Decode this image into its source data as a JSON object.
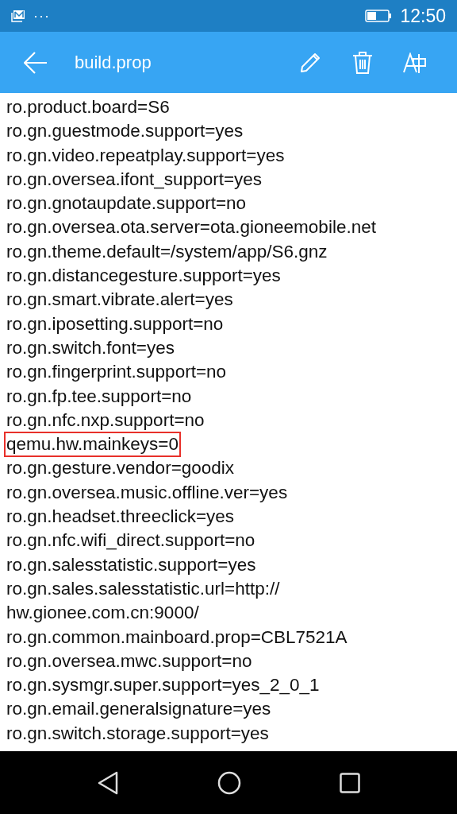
{
  "status_bar": {
    "time": "12:50",
    "overflow": "···"
  },
  "toolbar": {
    "title": "build.prop"
  },
  "lines": [
    {
      "text": "ro.product.board=S6",
      "highlighted": false
    },
    {
      "text": "ro.gn.guestmode.support=yes",
      "highlighted": false
    },
    {
      "text": "ro.gn.video.repeatplay.support=yes",
      "highlighted": false
    },
    {
      "text": "ro.gn.oversea.ifont_support=yes",
      "highlighted": false
    },
    {
      "text": "ro.gn.gnotaupdate.support=no",
      "highlighted": false
    },
    {
      "text": "ro.gn.oversea.ota.server=ota.gioneemobile.net",
      "highlighted": false
    },
    {
      "text": "ro.gn.theme.default=/system/app/S6.gnz",
      "highlighted": false
    },
    {
      "text": "ro.gn.distancegesture.support=yes",
      "highlighted": false
    },
    {
      "text": "ro.gn.smart.vibrate.alert=yes",
      "highlighted": false
    },
    {
      "text": "ro.gn.iposetting.support=no",
      "highlighted": false
    },
    {
      "text": "ro.gn.switch.font=yes",
      "highlighted": false
    },
    {
      "text": "ro.gn.fingerprint.support=no",
      "highlighted": false
    },
    {
      "text": "ro.gn.fp.tee.support=no",
      "highlighted": false
    },
    {
      "text": "ro.gn.nfc.nxp.support=no",
      "highlighted": false
    },
    {
      "text": "qemu.hw.mainkeys=0",
      "highlighted": true
    },
    {
      "text": "ro.gn.gesture.vendor=goodix",
      "highlighted": false
    },
    {
      "text": "ro.gn.oversea.music.offline.ver=yes",
      "highlighted": false
    },
    {
      "text": "ro.gn.headset.threeclick=yes",
      "highlighted": false
    },
    {
      "text": "ro.gn.nfc.wifi_direct.support=no",
      "highlighted": false
    },
    {
      "text": "ro.gn.salesstatistic.support=yes",
      "highlighted": false
    },
    {
      "text": "ro.gn.sales.salesstatistic.url=http://",
      "highlighted": false
    },
    {
      "text": "hw.gionee.com.cn:9000/",
      "highlighted": false
    },
    {
      "text": "ro.gn.common.mainboard.prop=CBL7521A",
      "highlighted": false
    },
    {
      "text": "ro.gn.oversea.mwc.support=no",
      "highlighted": false
    },
    {
      "text": "ro.gn.sysmgr.super.support=yes_2_0_1",
      "highlighted": false
    },
    {
      "text": "ro.gn.email.generalsignature=yes",
      "highlighted": false
    },
    {
      "text": "ro.gn.switch.storage.support=yes",
      "highlighted": false
    }
  ]
}
